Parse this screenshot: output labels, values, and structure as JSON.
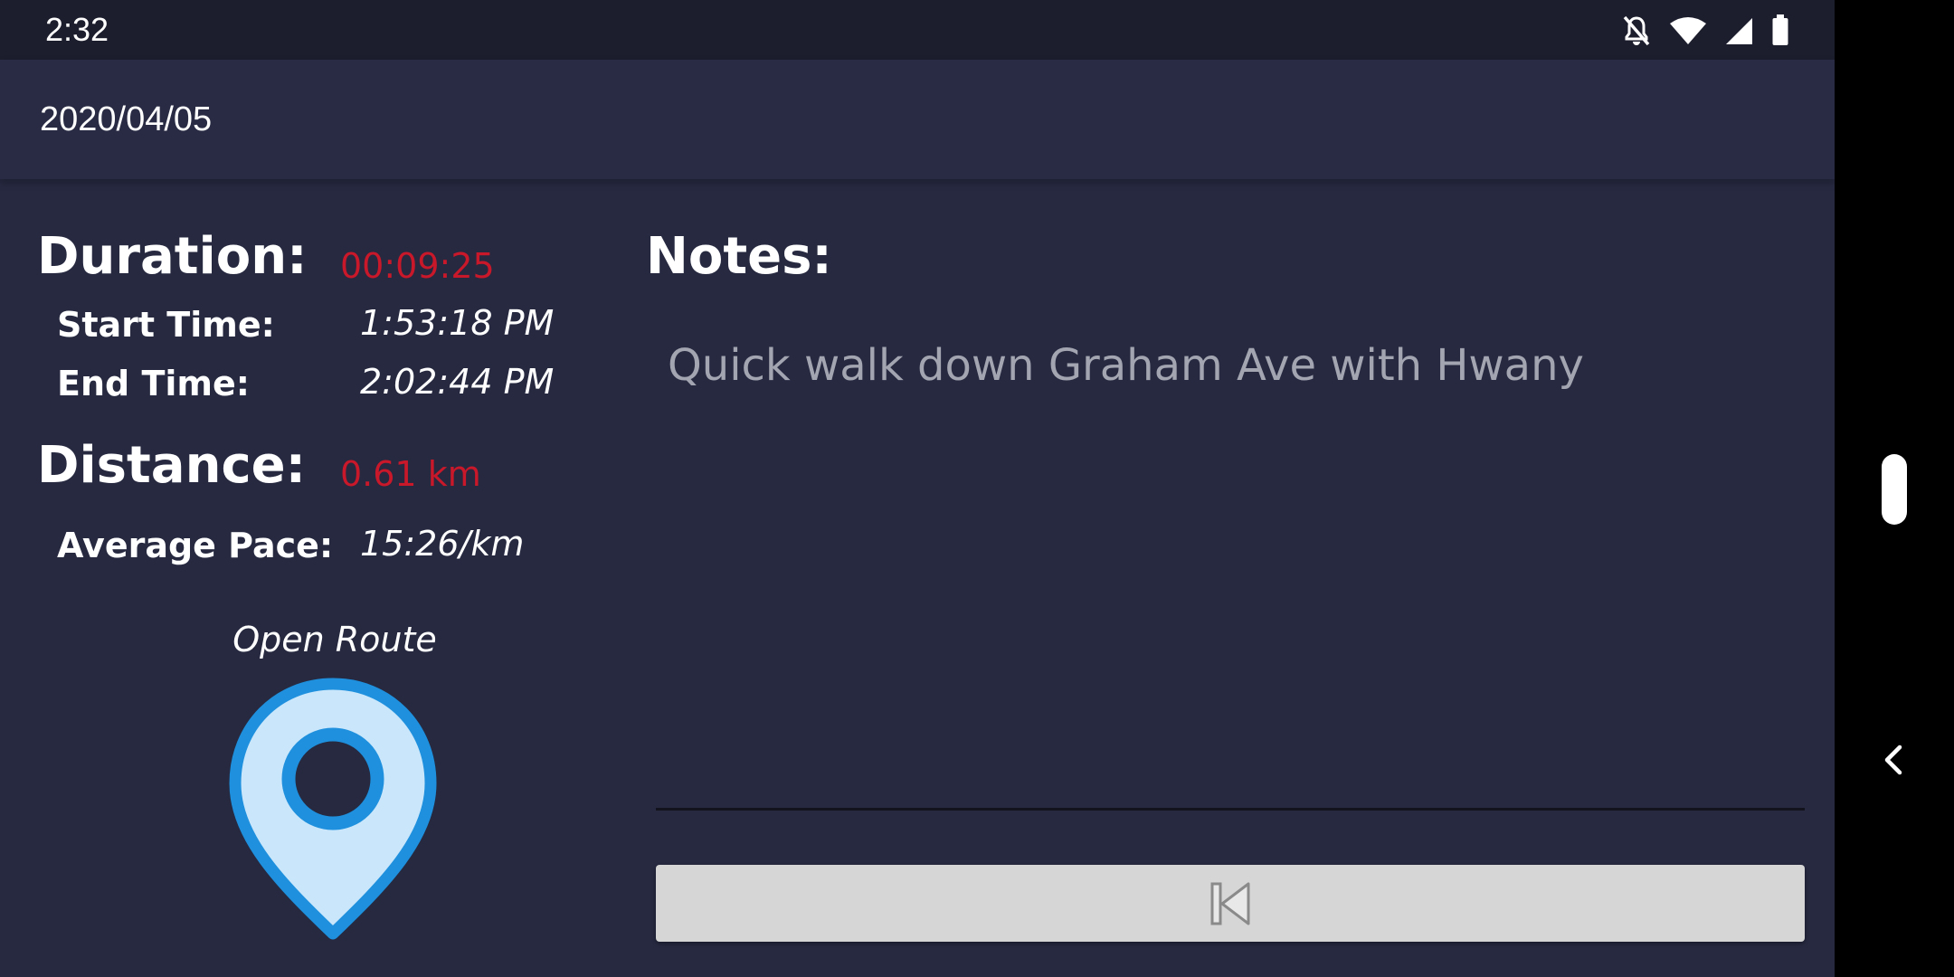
{
  "status_bar": {
    "time": "2:32",
    "icons": [
      "notifications-off-icon",
      "wifi-icon",
      "cell-signal-icon",
      "battery-icon"
    ]
  },
  "app_bar": {
    "title": "2020/04/05"
  },
  "stats": {
    "duration_label": "Duration:",
    "duration_value": "00:09:25",
    "start_label": "Start Time:",
    "start_value": "1:53:18 PM",
    "end_label": "End Time:",
    "end_value": "2:02:44 PM",
    "distance_label": "Distance:",
    "distance_value": "0.61 km",
    "pace_label": "Average Pace:",
    "pace_value": "15:26/km"
  },
  "route": {
    "label": "Open Route",
    "icon": "map-pin-icon"
  },
  "notes": {
    "label": "Notes:",
    "text": "Quick walk down Graham Ave with Hwany"
  },
  "back_button": {
    "icon": "skip-previous-icon"
  },
  "colors": {
    "background": "#262940",
    "status_bar": "#1c1e2d",
    "accent_red": "#c8182a",
    "pin_blue": "#1e90dd",
    "pin_fill": "#c9e6fb",
    "button_bg": "#d6d6d6"
  }
}
